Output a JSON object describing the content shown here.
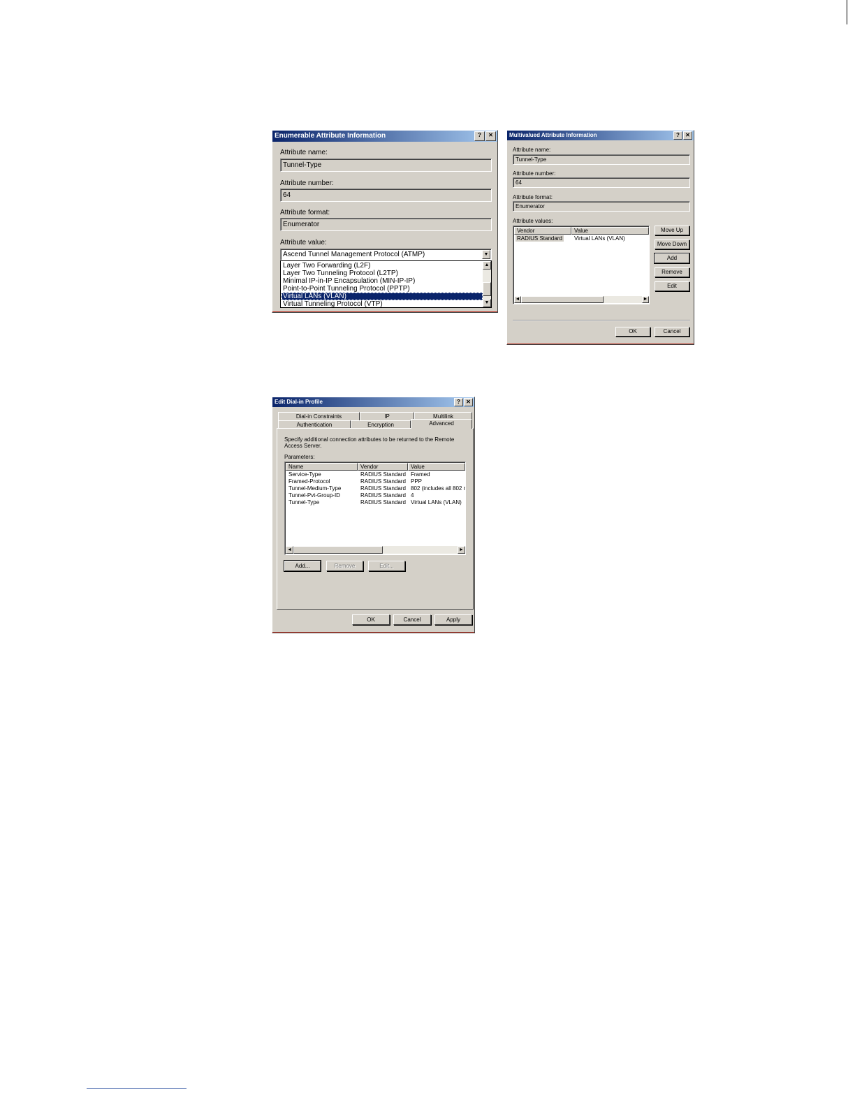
{
  "enumerable_dialog": {
    "title": "Enumerable Attribute Information",
    "help_label": "?",
    "close_label": "✕",
    "attribute_name_label": "Attribute name:",
    "attribute_name_value": "Tunnel-Type",
    "attribute_number_label": "Attribute number:",
    "attribute_number_value": "64",
    "attribute_format_label": "Attribute format:",
    "attribute_format_value": "Enumerator",
    "attribute_value_label": "Attribute value:",
    "dropdown_selected": "Ascend Tunnel Management Protocol (ATMP)",
    "options": [
      {
        "label": "Layer Two Forwarding (L2F)",
        "selected": false
      },
      {
        "label": "Layer Two Tunneling Protocol (L2TP)",
        "selected": false
      },
      {
        "label": "Minimal IP-in-IP Encapsulation (MIN-IP-IP)",
        "selected": false
      },
      {
        "label": "Point-to-Point Tunneling Protocol (PPTP)",
        "selected": false
      },
      {
        "label": "Virtual LANs (VLAN)",
        "selected": true
      },
      {
        "label": "Virtual Tunneling Protocol (VTP)",
        "selected": false
      }
    ]
  },
  "multivalued_dialog": {
    "title": "Multivalued Attribute Information",
    "help_label": "?",
    "close_label": "✕",
    "attribute_name_label": "Attribute name:",
    "attribute_name_value": "Tunnel-Type",
    "attribute_number_label": "Attribute number:",
    "attribute_number_value": "64",
    "attribute_format_label": "Attribute format:",
    "attribute_format_value": "Enumerator",
    "attribute_values_label": "Attribute values:",
    "columns": [
      "Vendor",
      "Value"
    ],
    "rows": [
      {
        "vendor": "RADIUS Standard",
        "value": "Virtual LANs (VLAN)"
      }
    ],
    "buttons": {
      "move_up": "Move Up",
      "move_down": "Move Down",
      "add": "Add",
      "remove": "Remove",
      "edit": "Edit",
      "ok": "OK",
      "cancel": "Cancel"
    }
  },
  "dialin_dialog": {
    "title": "Edit Dial-in Profile",
    "help_label": "?",
    "close_label": "✕",
    "tabs_row1": [
      "Dial-in Constraints",
      "IP",
      "Multilink"
    ],
    "tabs_row2": [
      "Authentication",
      "Encryption",
      "Advanced"
    ],
    "description": "Specify additional connection attributes to be returned to the Remote Access Server.",
    "parameters_label": "Parameters:",
    "columns": [
      "Name",
      "Vendor",
      "Value"
    ],
    "rows": [
      {
        "name": "Service-Type",
        "vendor": "RADIUS Standard",
        "value": "Framed"
      },
      {
        "name": "Framed-Protocol",
        "vendor": "RADIUS Standard",
        "value": "PPP"
      },
      {
        "name": "Tunnel-Medium-Type",
        "vendor": "RADIUS Standard",
        "value": "802 (includes all 802 m"
      },
      {
        "name": "Tunnel-Pvt-Group-ID",
        "vendor": "RADIUS Standard",
        "value": "4"
      },
      {
        "name": "Tunnel-Type",
        "vendor": "RADIUS Standard",
        "value": "Virtual LANs (VLAN)"
      }
    ],
    "buttons": {
      "add": "Add...",
      "remove": "Remove",
      "edit": "Edit...",
      "ok": "OK",
      "cancel": "Cancel",
      "apply": "Apply"
    }
  },
  "icons": {
    "scroll_left": "◄",
    "scroll_right": "►",
    "scroll_up": "▲",
    "scroll_down": "▼"
  }
}
